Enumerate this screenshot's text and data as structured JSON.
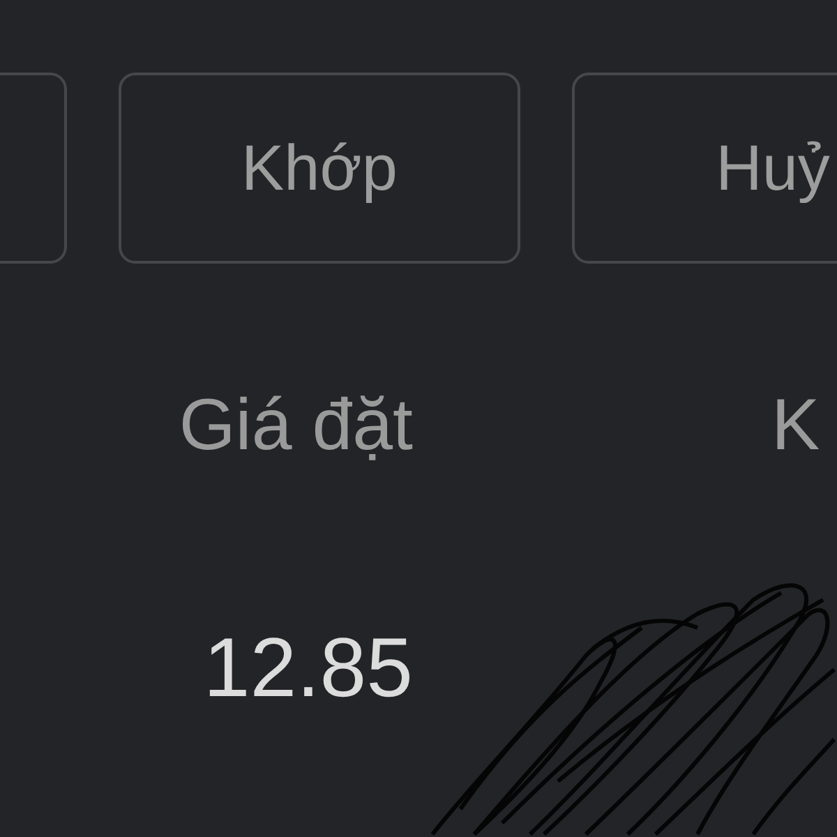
{
  "filter_buttons": [
    {
      "kind": "blank"
    },
    {
      "kind": "text",
      "label": "Khớp"
    },
    {
      "kind": "text",
      "label": "Huỷ"
    }
  ],
  "columns": [
    {
      "header": "Giá đặt",
      "value": "12.85"
    },
    {
      "header": "K"
    }
  ],
  "scribble": {
    "kind": "scribble"
  }
}
